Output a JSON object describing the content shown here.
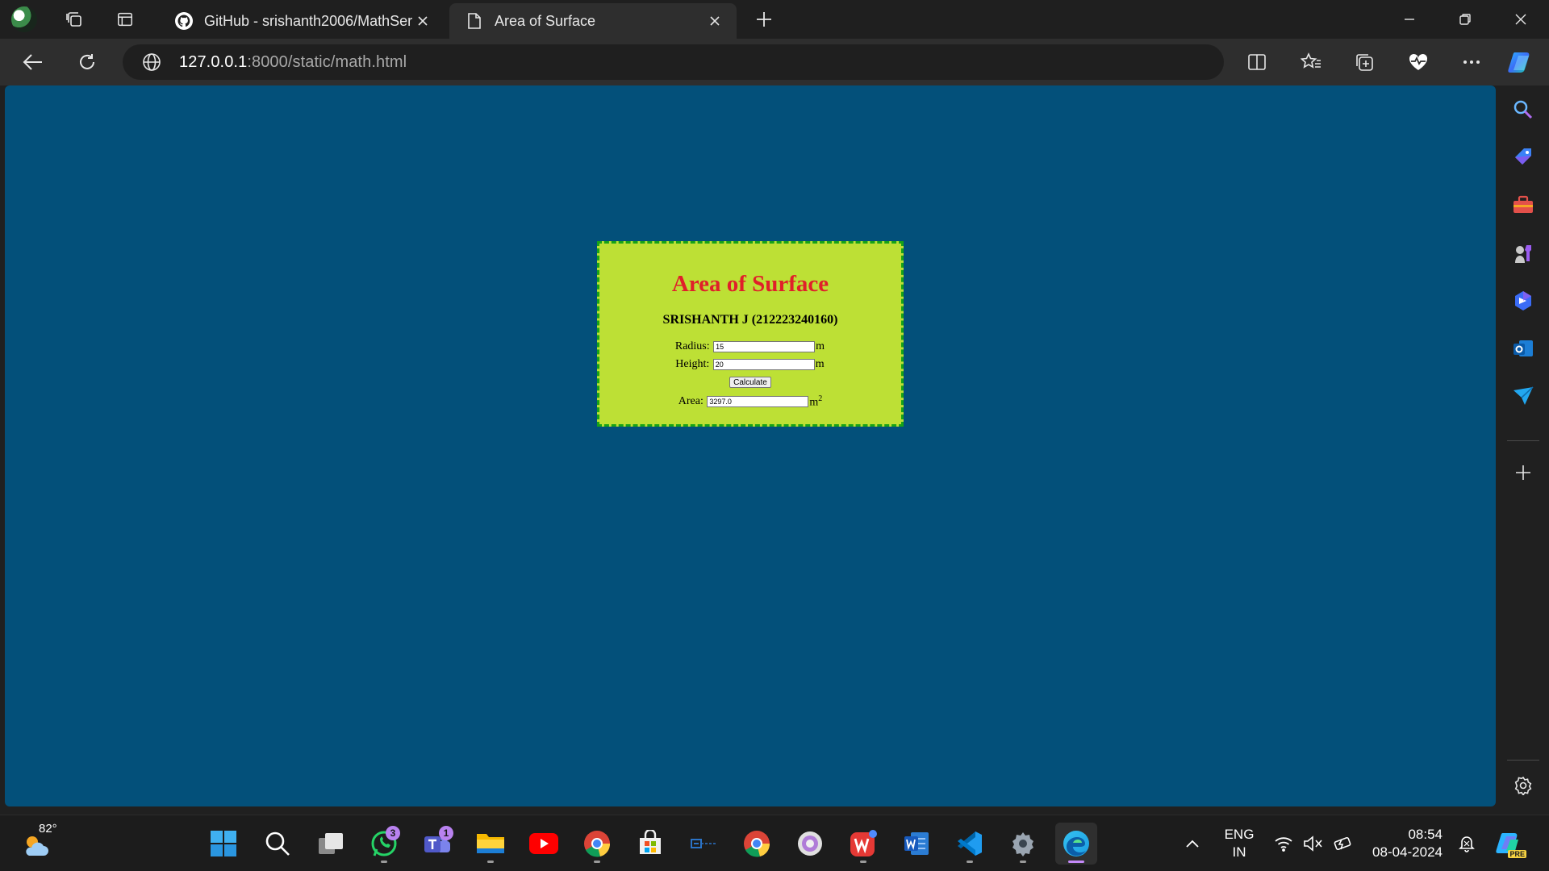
{
  "browser": {
    "tabs": [
      {
        "title": "GitHub - srishanth2006/MathSer",
        "icon": "github-icon",
        "active": false
      },
      {
        "title": "Area of Surface",
        "icon": "page-icon",
        "active": true
      }
    ],
    "url_host": "127.0.0.1",
    "url_path": ":8000/static/math.html"
  },
  "page": {
    "heading": "Area of Surface",
    "author": "SRISHANTH J (212223240160)",
    "radius_label": "Radius:",
    "radius_value": "15",
    "radius_unit": "m",
    "height_label": "Height:",
    "height_value": "20",
    "height_unit": "m",
    "calculate_label": "Calculate",
    "area_label": "Area:",
    "area_value": "3297.0",
    "area_unit": "m",
    "area_unit_exp": "2",
    "colors": {
      "background": "#03507a",
      "card": "#bde035",
      "border": "#17a317",
      "heading": "#e0202a"
    }
  },
  "taskbar": {
    "weather_temp": "82°",
    "whatsapp_badge": "3",
    "teams_badge": "1",
    "lang_primary": "ENG",
    "lang_secondary": "IN",
    "time": "08:54",
    "date": "08-04-2024",
    "copilot_label": "PRE"
  }
}
